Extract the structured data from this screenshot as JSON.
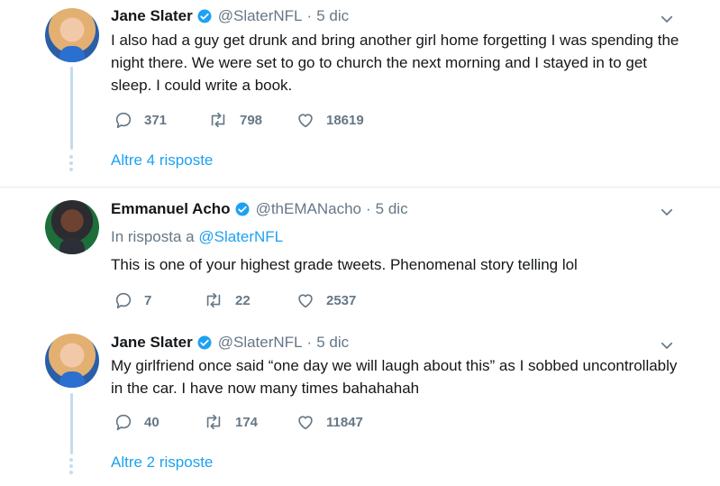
{
  "tweets": [
    {
      "name": "Jane Slater",
      "handle": "@SlaterNFL",
      "date": "5 dic",
      "text": "I also had a guy get drunk and bring another girl home forgetting I was spending the night there. We were set to go to church the next morning and I stayed in to get sleep. I could write a book.",
      "replies": "371",
      "retweets": "798",
      "likes": "18619",
      "more_replies": "Altre 4 risposte"
    },
    {
      "name": "Emmanuel Acho",
      "handle": "@thEMANacho",
      "date": "5 dic",
      "reply_to_label": "In risposta a",
      "reply_to_handle": "@SlaterNFL",
      "text": "This is one of your highest grade tweets. Phenomenal story telling lol",
      "replies": "7",
      "retweets": "22",
      "likes": "2537"
    },
    {
      "name": "Jane Slater",
      "handle": "@SlaterNFL",
      "date": "5 dic",
      "text": "My girlfriend once said “one day we will laugh about this” as I sobbed uncontrollably in the car. I have now many times bahahahah",
      "replies": "40",
      "retweets": "174",
      "likes": "11847",
      "more_replies": "Altre 2 risposte"
    }
  ],
  "separator": "·",
  "icons": {
    "verified": "verified-badge-icon",
    "reply": "reply-icon",
    "retweet": "retweet-icon",
    "like": "heart-icon",
    "chevron": "chevron-down-icon"
  },
  "colors": {
    "link": "#1da1f2",
    "muted": "#657786",
    "thread": "#c4dbef"
  }
}
